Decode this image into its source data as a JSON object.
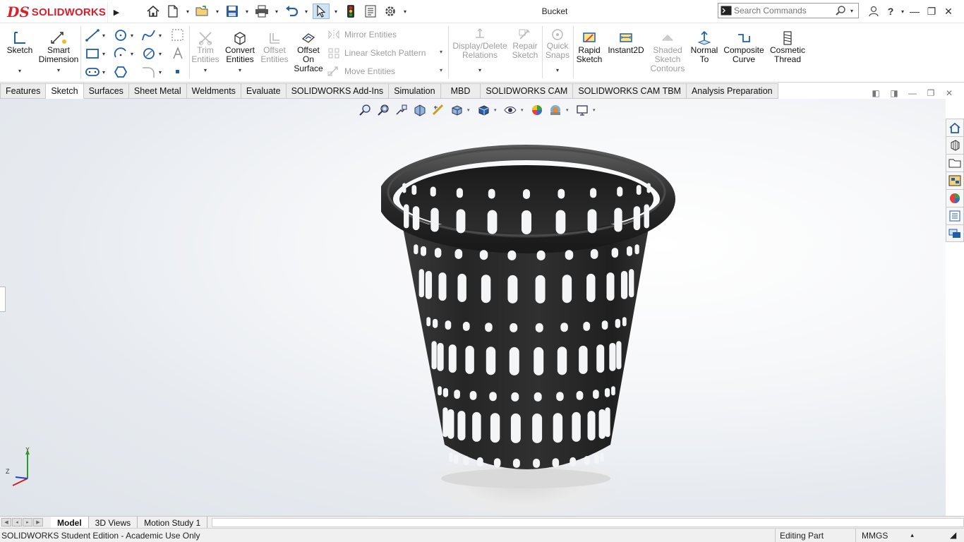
{
  "app": {
    "logo_text": "SOLIDWORKS",
    "document_title": "Bucket"
  },
  "search": {
    "placeholder": "Search Commands"
  },
  "ribbon": {
    "sketch": "Sketch",
    "smart_dimension": [
      "Smart",
      "Dimension"
    ],
    "trim_entities": [
      "Trim",
      "Entities"
    ],
    "convert_entities": [
      "Convert",
      "Entities"
    ],
    "offset_entities": [
      "Offset",
      "Entities"
    ],
    "offset_on_surface": [
      "Offset",
      "On",
      "Surface"
    ],
    "mirror_entities": "Mirror Entities",
    "linear_sketch_pattern": "Linear Sketch Pattern",
    "move_entities": "Move Entities",
    "display_delete_relations": [
      "Display/Delete",
      "Relations"
    ],
    "repair_sketch": [
      "Repair",
      "Sketch"
    ],
    "quick_snaps": [
      "Quick",
      "Snaps"
    ],
    "rapid_sketch": [
      "Rapid",
      "Sketch"
    ],
    "instant2d": "Instant2D",
    "shaded_sketch_contours": [
      "Shaded",
      "Sketch",
      "Contours"
    ],
    "normal_to": [
      "Normal",
      "To"
    ],
    "composite_curve": [
      "Composite",
      "Curve"
    ],
    "cosmetic_thread": [
      "Cosmetic",
      "Thread"
    ]
  },
  "command_tabs": [
    "Features",
    "Sketch",
    "Surfaces",
    "Sheet Metal",
    "Weldments",
    "Evaluate",
    "SOLIDWORKS Add-Ins",
    "Simulation",
    "MBD",
    "SOLIDWORKS CAM",
    "SOLIDWORKS CAM TBM",
    "Analysis Preparation"
  ],
  "active_command_tab": "Sketch",
  "triad": {
    "x": "",
    "y": "Y",
    "z": "Z"
  },
  "bottom_tabs": [
    "Model",
    "3D Views",
    "Motion Study 1"
  ],
  "active_bottom_tab": "Model",
  "status": {
    "edition": "SOLIDWORKS Student Edition - Academic Use Only",
    "mode": "Editing Part",
    "units": "MMGS"
  },
  "colors": {
    "brand": "#d9202a",
    "bucket": "#2b2b2b",
    "icon_blue": "#1f5ea8"
  }
}
